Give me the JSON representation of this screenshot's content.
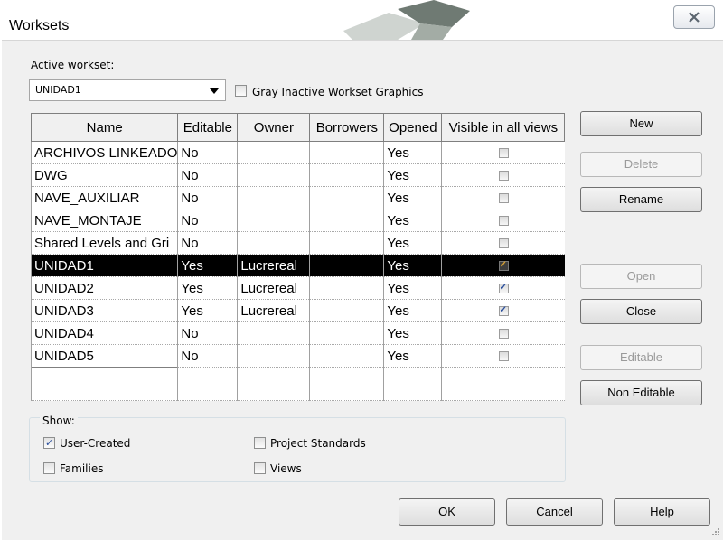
{
  "window": {
    "title": "Worksets"
  },
  "active_workset": {
    "label": "Active workset:",
    "value": "UNIDAD1",
    "gray_inactive": {
      "label": "Gray Inactive Workset Graphics",
      "checked": false
    }
  },
  "table": {
    "columns": [
      "Name",
      "Editable",
      "Owner",
      "Borrowers",
      "Opened",
      "Visible in all views"
    ],
    "rows": [
      {
        "name": "ARCHIVOS LINKEADO",
        "editable": "No",
        "owner": "",
        "borrowers": "",
        "opened": "Yes",
        "visible": false
      },
      {
        "name": "DWG",
        "editable": "No",
        "owner": "",
        "borrowers": "",
        "opened": "Yes",
        "visible": false
      },
      {
        "name": "NAVE_AUXILIAR",
        "editable": "No",
        "owner": "",
        "borrowers": "",
        "opened": "Yes",
        "visible": false
      },
      {
        "name": "NAVE_MONTAJE",
        "editable": "No",
        "owner": "",
        "borrowers": "",
        "opened": "Yes",
        "visible": false
      },
      {
        "name": "Shared Levels and Gri",
        "editable": "No",
        "owner": "",
        "borrowers": "",
        "opened": "Yes",
        "visible": false
      },
      {
        "name": "UNIDAD1",
        "editable": "Yes",
        "owner": "Lucrereal",
        "borrowers": "",
        "opened": "Yes",
        "visible": true,
        "selected": true
      },
      {
        "name": "UNIDAD2",
        "editable": "Yes",
        "owner": "Lucrereal",
        "borrowers": "",
        "opened": "Yes",
        "visible": true
      },
      {
        "name": "UNIDAD3",
        "editable": "Yes",
        "owner": "Lucrereal",
        "borrowers": "",
        "opened": "Yes",
        "visible": true
      },
      {
        "name": "UNIDAD4",
        "editable": "No",
        "owner": "",
        "borrowers": "",
        "opened": "Yes",
        "visible": false
      },
      {
        "name": "UNIDAD5",
        "editable": "No",
        "owner": "",
        "borrowers": "",
        "opened": "Yes",
        "visible": false
      }
    ]
  },
  "side_buttons": {
    "new": "New",
    "delete": "Delete",
    "rename": "Rename",
    "open": "Open",
    "close": "Close",
    "editable": "Editable",
    "non_editable": "Non Editable"
  },
  "show": {
    "label": "Show:",
    "user_created": {
      "label": "User-Created",
      "checked": true
    },
    "families": {
      "label": "Families",
      "checked": false
    },
    "project_standards": {
      "label": "Project Standards",
      "checked": false
    },
    "views": {
      "label": "Views",
      "checked": false
    }
  },
  "footer": {
    "ok": "OK",
    "cancel": "Cancel",
    "help": "Help"
  },
  "colors": {
    "selection_bg": "#000000",
    "selection_text": "#ffffff",
    "check_blue": "#2a4f9d",
    "check_gold": "#d9a233"
  }
}
